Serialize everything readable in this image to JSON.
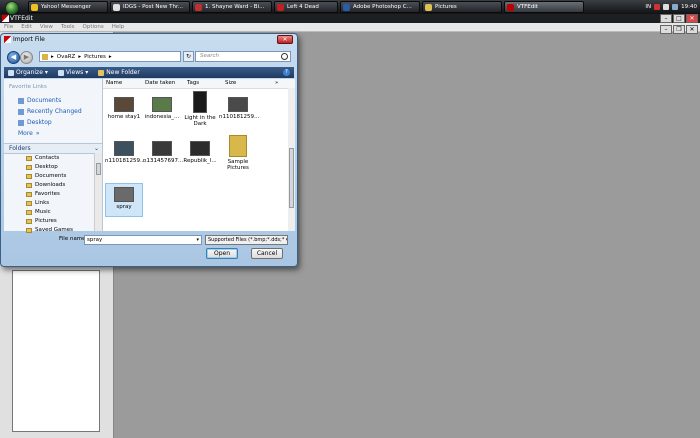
{
  "taskbar": {
    "tasks": [
      {
        "label": "Yahoo! Messenger",
        "color": "#f0c020"
      },
      {
        "label": "IDGS - Post New Thr...",
        "color": "#e0e0e0"
      },
      {
        "label": "1. Shayne Ward - Bi...",
        "color": "#c03030"
      },
      {
        "label": "Left 4 Dead",
        "color": "#c02020"
      },
      {
        "label": "Adobe Photoshop C...",
        "color": "#2a5ca8"
      },
      {
        "label": "Pictures",
        "color": "#e0c050"
      },
      {
        "label": "VTFEdit",
        "color": "#c00000"
      }
    ],
    "tray": {
      "lang": "IN",
      "clock": "19:40"
    }
  },
  "app": {
    "title": "VTFEdit",
    "menu": [
      "File",
      "Edit",
      "View",
      "Tools",
      "Options",
      "Help"
    ]
  },
  "dialog": {
    "title": "Import File",
    "address": [
      "OvaRZ",
      "Pictures"
    ],
    "search_placeholder": "Search",
    "toolbar": {
      "organize": "Organize",
      "views": "Views",
      "new_folder": "New Folder"
    },
    "favorite_links_header": "Favorite Links",
    "favorite_links": [
      "Documents",
      "Recently Changed",
      "Desktop"
    ],
    "more_label": "More",
    "folders_label": "Folders",
    "folder_tree": [
      "Contacts",
      "Desktop",
      "Documents",
      "Downloads",
      "Favorites",
      "Links",
      "Music",
      "Pictures",
      "Saved Games"
    ],
    "columns": [
      "Name",
      "Date taken",
      "Tags",
      "Size"
    ],
    "files": [
      {
        "name": "home stay1",
        "color": "#5a4838"
      },
      {
        "name": "indonesia_...",
        "color": "#5b7a4a"
      },
      {
        "name": "Light in the Dark",
        "color": "#1a1a1a"
      },
      {
        "name": "n110181259...",
        "color": "#4a4a4a"
      },
      {
        "name": "n110181259...",
        "color": "#3c5060"
      },
      {
        "name": "n131457697...",
        "color": "#3a3a3a"
      },
      {
        "name": "Republik_l...",
        "color": "#2d2d2d"
      },
      {
        "name": "Sample Pictures",
        "color": "#d8b84a"
      },
      {
        "name": "spray",
        "color": "#6a6a6a"
      }
    ],
    "filename_label": "File name:",
    "filename_value": "spray",
    "filetype_value": "Supported Files (*.bmp;*.dds;*",
    "open_label": "Open",
    "cancel_label": "Cancel"
  }
}
